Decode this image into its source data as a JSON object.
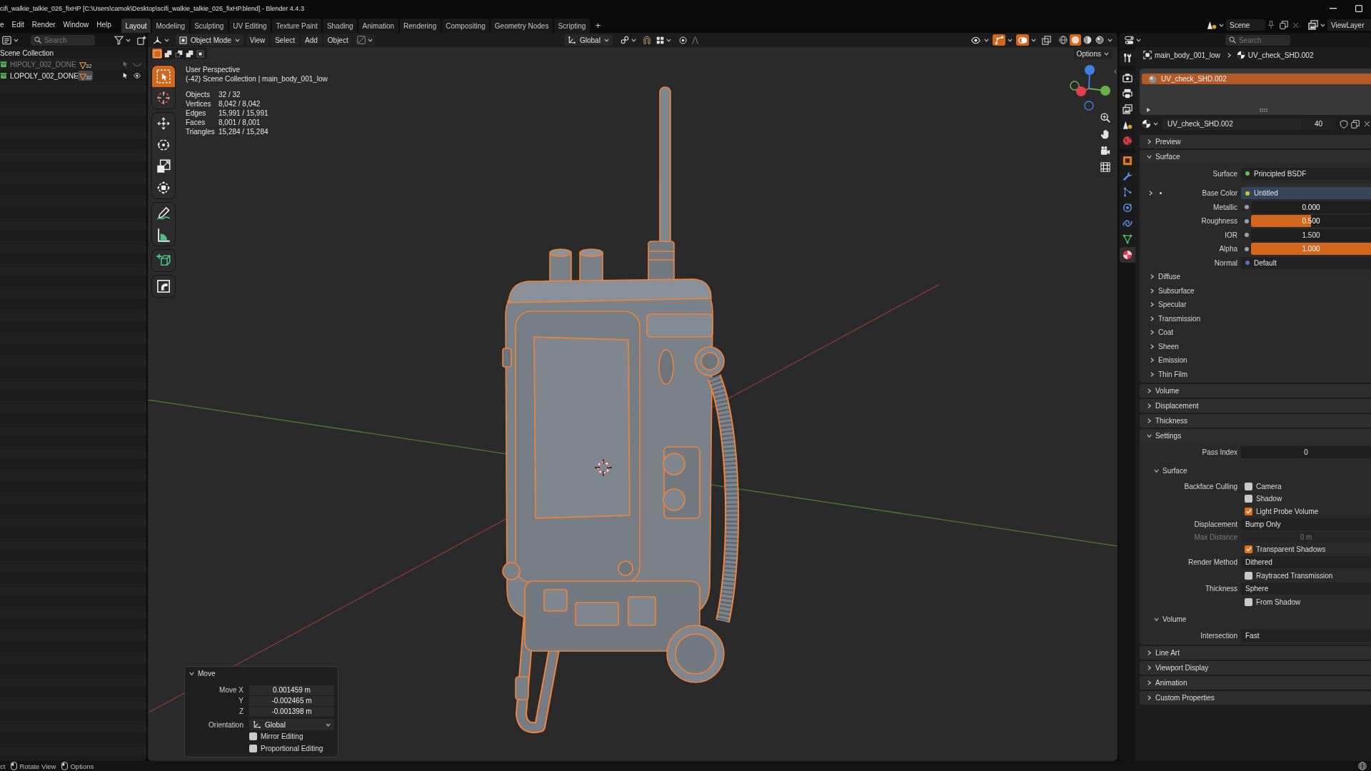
{
  "title_bar": {
    "title": "cifi_walkie_talkie_026_fixHP [C:\\Users\\camok\\Desktop\\scifi_walkie_talkie_026_fixHP.blend] - Blender 4.4.3"
  },
  "top_bar": {
    "menus": [
      "e",
      "Edit",
      "Render",
      "Window",
      "Help"
    ],
    "workspaces": [
      {
        "label": "Layout",
        "selected": true
      },
      {
        "label": "Modeling",
        "selected": false
      },
      {
        "label": "Sculpting",
        "selected": false
      },
      {
        "label": "UV Editing",
        "selected": false
      },
      {
        "label": "Texture Paint",
        "selected": false
      },
      {
        "label": "Shading",
        "selected": false
      },
      {
        "label": "Animation",
        "selected": false
      },
      {
        "label": "Rendering",
        "selected": false
      },
      {
        "label": "Compositing",
        "selected": false
      },
      {
        "label": "Geometry Nodes",
        "selected": false
      },
      {
        "label": "Scripting",
        "selected": false
      }
    ],
    "add_workspace": "+",
    "scene": "Scene",
    "view_layer": "ViewLayer"
  },
  "outliner": {
    "search": {
      "placeholder": "Search"
    },
    "root": "Scene Collection",
    "collections": [
      {
        "name": "HIPOLY_002_DONE",
        "object_count": "32",
        "visible": false,
        "active": false
      },
      {
        "name": "LOPOLY_002_DONE",
        "object_count": "32",
        "visible": true,
        "active": true
      }
    ]
  },
  "viewport": {
    "header": {
      "mode": "Object Mode",
      "menus": [
        "View",
        "Select",
        "Add",
        "Object"
      ],
      "orientation": "Global",
      "toggles": [
        {
          "kind": "visibility",
          "on": false
        },
        {
          "kind": "gizmo",
          "on": true
        },
        {
          "kind": "overlay",
          "on": true
        },
        {
          "kind": "xray",
          "on": false
        }
      ],
      "shading": [
        {
          "kind": "wireframe",
          "selected": false
        },
        {
          "kind": "solid",
          "selected": true
        },
        {
          "kind": "material",
          "selected": false
        },
        {
          "kind": "rendered",
          "selected": false
        }
      ]
    },
    "select_modes": [
      {
        "kind": "new",
        "selected": true
      },
      {
        "kind": "extend",
        "selected": false
      },
      {
        "kind": "subtract",
        "selected": false
      },
      {
        "kind": "invert",
        "selected": false
      },
      {
        "kind": "intersect",
        "selected": false
      }
    ],
    "options": "Options",
    "tool_groups": [
      [
        {
          "kind": "select_box",
          "selected": true
        },
        {
          "kind": "cursor",
          "selected": false
        }
      ],
      [
        {
          "kind": "move",
          "selected": false
        },
        {
          "kind": "rotate",
          "selected": false
        },
        {
          "kind": "scale",
          "selected": false
        },
        {
          "kind": "transform",
          "selected": false
        }
      ],
      [
        {
          "kind": "annotate",
          "selected": false
        },
        {
          "kind": "measure",
          "selected": false
        }
      ],
      [
        {
          "kind": "add_cube",
          "selected": false
        }
      ],
      [
        {
          "kind": "shear",
          "selected": false
        }
      ]
    ],
    "view_name": "User Perspective",
    "context": "(-42) Scene Collection | main_body_001_low",
    "stats": [
      {
        "label": "Objects",
        "value": "32 / 32"
      },
      {
        "label": "Vertices",
        "value": "8,042 / 8,042"
      },
      {
        "label": "Edges",
        "value": "15,991 / 15,991"
      },
      {
        "label": "Faces",
        "value": "8,001 / 8,001"
      },
      {
        "label": "Triangles",
        "value": "15,284 / 15,284"
      }
    ],
    "last_operator": {
      "title": "Move",
      "expanded": true,
      "fields": [
        {
          "label": "Move X",
          "value": "0.001459 m"
        },
        {
          "label": "Y",
          "value": "-0.002465 m"
        },
        {
          "label": "Z",
          "value": "-0.001398 m"
        }
      ],
      "orientation": {
        "label": "Orientation",
        "value": "Global"
      },
      "options": [
        {
          "label": "Mirror Editing",
          "checked": false
        },
        {
          "label": "Proportional Editing",
          "checked": false
        }
      ]
    }
  },
  "properties": {
    "search": {
      "placeholder": "Search"
    },
    "tab_groups": [
      [
        {
          "kind": "tool",
          "selected": false
        }
      ],
      [
        {
          "kind": "render",
          "selected": false
        },
        {
          "kind": "output",
          "selected": false
        },
        {
          "kind": "view_layer",
          "selected": false
        },
        {
          "kind": "scene",
          "selected": false
        },
        {
          "kind": "world",
          "selected": false
        }
      ],
      [
        {
          "kind": "object",
          "selected": false
        },
        {
          "kind": "modifiers",
          "selected": false
        },
        {
          "kind": "particles",
          "selected": false
        },
        {
          "kind": "physics",
          "selected": false
        },
        {
          "kind": "constraints",
          "selected": false
        },
        {
          "kind": "data",
          "selected": false
        },
        {
          "kind": "material",
          "selected": true
        }
      ]
    ],
    "breadcrumb": [
      {
        "kind": "object",
        "label": "main_body_001_low"
      },
      {
        "kind": "material",
        "label": "UV_check_SHD.002"
      }
    ],
    "material_slots": [
      {
        "name": "UV_check_SHD.002",
        "selected": true
      }
    ],
    "material": {
      "name": "UV_check_SHD.002",
      "users": "40"
    },
    "panels": [
      {
        "title": "Preview",
        "expanded": false
      },
      {
        "title": "Surface",
        "expanded": true,
        "items": [
          {
            "kind": "shader",
            "label": "Surface",
            "value": "Principled BSDF",
            "color": "#5fc45f"
          },
          {
            "kind": "texture",
            "label": "Base Color",
            "value": "Untitled",
            "color": "#c7c729",
            "expanded": false
          },
          {
            "kind": "slider",
            "label": "Metallic",
            "value": "0.000",
            "color": "#a1a1a1"
          },
          {
            "kind": "slider",
            "label": "Roughness",
            "value": "0.500",
            "level": 0.5,
            "color": "#a1a1a1"
          },
          {
            "kind": "number",
            "label": "IOR",
            "value": "1.500",
            "color": "#a1a1a1"
          },
          {
            "kind": "slider",
            "label": "Alpha",
            "value": "1.000",
            "level": 1,
            "color": "#a1a1a1"
          },
          {
            "kind": "link",
            "label": "Normal",
            "value": "Default",
            "color": "#6363c7"
          },
          {
            "kind": "subpanel",
            "title": "Diffuse",
            "expanded": false
          },
          {
            "kind": "subpanel",
            "title": "Subsurface",
            "expanded": false
          },
          {
            "kind": "subpanel",
            "title": "Specular",
            "expanded": false
          },
          {
            "kind": "subpanel",
            "title": "Transmission",
            "expanded": false
          },
          {
            "kind": "subpanel",
            "title": "Coat",
            "expanded": false
          },
          {
            "kind": "subpanel",
            "title": "Sheen",
            "expanded": false
          },
          {
            "kind": "subpanel",
            "title": "Emission",
            "expanded": false
          },
          {
            "kind": "subpanel",
            "title": "Thin Film",
            "expanded": false
          }
        ]
      },
      {
        "title": "Volume",
        "expanded": false
      },
      {
        "title": "Displacement",
        "expanded": false
      },
      {
        "title": "Thickness",
        "expanded": false
      },
      {
        "title": "Settings",
        "expanded": true,
        "items": [
          {
            "kind": "number",
            "label": "Pass Index",
            "value": "0"
          },
          {
            "kind": "subpanel",
            "title": "Surface",
            "expanded": true,
            "items": [
              {
                "kind": "checkbox",
                "label": "Backface Culling",
                "text": "Camera",
                "checked": false
              },
              {
                "kind": "checkbox",
                "text": "Shadow",
                "checked": false
              },
              {
                "kind": "checkbox",
                "text": "Light Probe Volume",
                "checked": true
              },
              {
                "kind": "dropdown",
                "label": "Displacement",
                "value": "Bump Only"
              },
              {
                "kind": "number",
                "label": "Max Distance",
                "value": "0 m",
                "disabled": true
              },
              {
                "kind": "checkbox",
                "text": "Transparent Shadows",
                "checked": true
              },
              {
                "kind": "dropdown",
                "label": "Render Method",
                "value": "Dithered"
              },
              {
                "kind": "checkbox",
                "text": "Raytraced Transmission",
                "checked": false
              },
              {
                "kind": "dropdown",
                "label": "Thickness",
                "value": "Sphere"
              },
              {
                "kind": "checkbox",
                "text": "From Shadow",
                "checked": false
              }
            ]
          },
          {
            "kind": "subpanel",
            "title": "Volume",
            "expanded": true,
            "items": [
              {
                "kind": "dropdown",
                "label": "Intersection",
                "value": "Fast"
              }
            ]
          }
        ]
      },
      {
        "title": "Line Art",
        "expanded": false
      },
      {
        "title": "Viewport Display",
        "expanded": false
      },
      {
        "title": "Animation",
        "expanded": false
      },
      {
        "title": "Custom Properties",
        "expanded": false
      }
    ]
  },
  "status_bar": {
    "hints": [
      {
        "kind": "text",
        "label": "ct"
      },
      {
        "kind": "mouse",
        "label": "Rotate View"
      },
      {
        "kind": "mouse",
        "label": "Options"
      }
    ]
  }
}
